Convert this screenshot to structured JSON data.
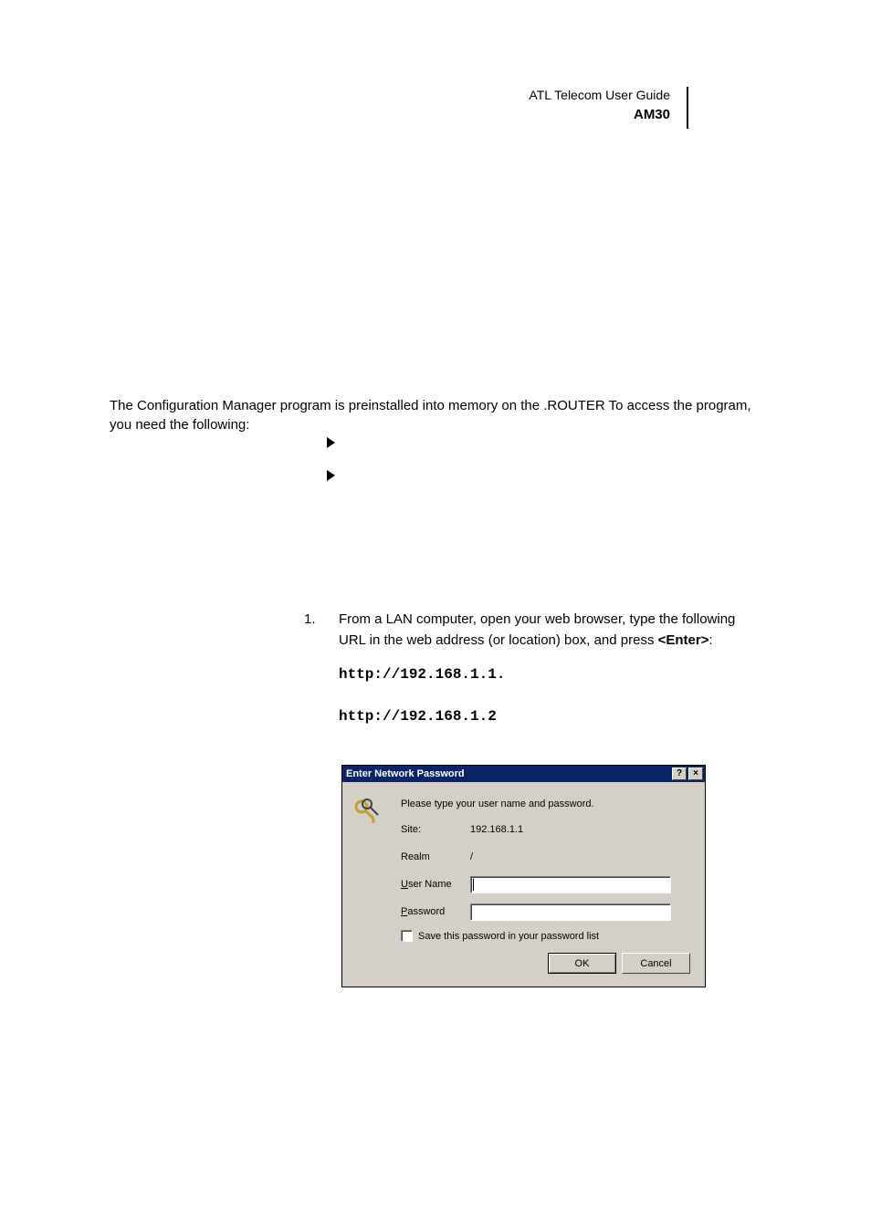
{
  "header": {
    "guide": "ATL Telecom User Guide",
    "model": "AM30"
  },
  "intro": "The Configuration Manager program is preinstalled into memory on the .ROUTER To access the program, you need the following:",
  "step": {
    "number": "1.",
    "text_before": "From a LAN computer, open your web browser, type the following URL in the web address (or location) box, and press ",
    "text_bold": "<Enter>",
    "text_after": ":"
  },
  "urls": {
    "primary": "http://192.168.1.1.",
    "secondary": "http://192.168.1.2"
  },
  "dialog": {
    "title": "Enter Network Password",
    "help_glyph": "?",
    "close_glyph": "×",
    "prompt": "Please type your user name and password.",
    "site_label": "Site:",
    "site_value": "192.168.1.1",
    "realm_label": "Realm",
    "realm_value": "/",
    "username_u": "U",
    "username_rest": "ser Name",
    "password_u": "P",
    "password_rest": "assword",
    "save_u": "S",
    "save_rest": "ave this password in your password list",
    "ok_label": "OK",
    "cancel_label": "Cancel"
  }
}
